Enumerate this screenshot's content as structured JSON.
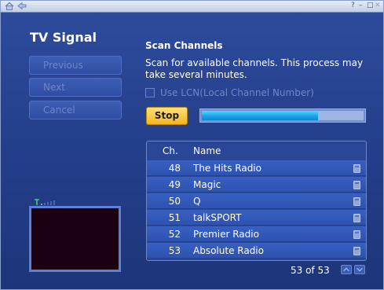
{
  "titlebar": {
    "home_icon": "home-icon",
    "back_icon": "back-arrow-icon",
    "controls": [
      "help-icon",
      "minimize-icon",
      "restore-icon",
      "close-icon"
    ],
    "help_glyph": "?",
    "minimize_glyph": "–",
    "restore_glyph": "□",
    "close_glyph": "✕"
  },
  "page": {
    "heading": "TV Signal",
    "nav": {
      "previous": "Previous",
      "next": "Next",
      "cancel": "Cancel"
    }
  },
  "scan": {
    "title": "Scan Channels",
    "description": "Scan for available channels. This process may take several minutes.",
    "lcn_label": "Use LCN(Local Channel Number)",
    "lcn_checked": false,
    "stop_label": "Stop",
    "progress_fraction": 0.72
  },
  "channels": {
    "headers": {
      "ch": "Ch.",
      "name": "Name"
    },
    "rows": [
      {
        "ch": "48",
        "name": "The Hits Radio",
        "icon": "radio-icon"
      },
      {
        "ch": "49",
        "name": "Magic",
        "icon": "radio-icon"
      },
      {
        "ch": "50",
        "name": "Q",
        "icon": "radio-icon"
      },
      {
        "ch": "51",
        "name": "talkSPORT",
        "icon": "radio-icon"
      },
      {
        "ch": "52",
        "name": "Premier Radio",
        "icon": "radio-icon"
      },
      {
        "ch": "53",
        "name": "Absolute Radio",
        "icon": "radio-icon"
      }
    ],
    "page_count": "53 of 53"
  },
  "colors": {
    "accent_button": "#f4b51d",
    "progress": "#1aa3e8",
    "background": "#26418e"
  }
}
